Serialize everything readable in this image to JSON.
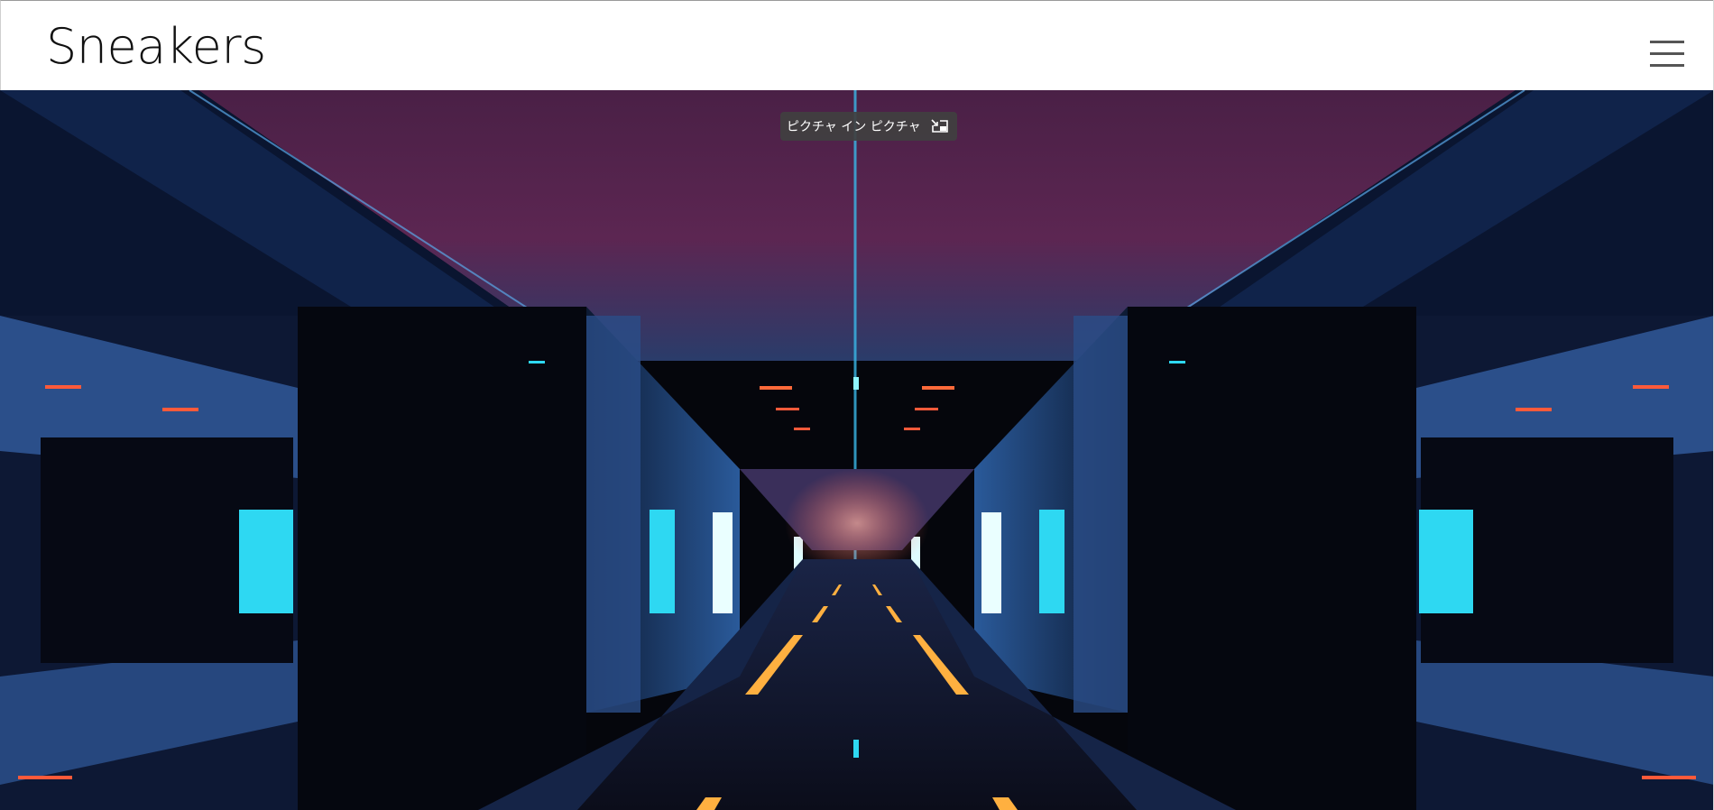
{
  "header": {
    "logo_text": "Sneakers",
    "menu_icon": "hamburger-menu-icon"
  },
  "video": {
    "scene": "neon-corridor",
    "colors": {
      "neon_cyan": "#27d8f0",
      "neon_orange": "#ff9a2a",
      "neon_red": "#ff4a3a",
      "ceiling_magenta": "#5a2350",
      "wall_blue": "#2a5c9a",
      "dark": "#05060c"
    }
  },
  "pip_button": {
    "label": "ピクチャ イン ピクチャ",
    "icon": "picture-in-picture-icon"
  }
}
